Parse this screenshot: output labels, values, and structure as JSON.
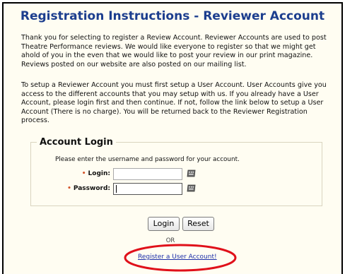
{
  "page": {
    "title": "Registration Instructions - Reviewer Account",
    "paragraph_1": "Thank you for selecting to register a Review Account. Reviewer Accounts are used to post Theatre Performance reviews. We would like everyone to register so that we might get ahold of you in the even that we would like to post your review in our print magazine. Reviews posted on our website are also posted on our mailing list.",
    "paragraph_2": "To setup a Reviewer Account you must first setup a User Account. User Accounts give you access to the different accounts that you may setup with us. If you already have a User Account, please login first and then continue. If not, follow the link below to setup a User Account (There is no charge). You will be returned back to the Reviewer Registration process."
  },
  "login": {
    "legend": "Account Login",
    "instructions": "Please enter the username and password for your account.",
    "required_marker": "•",
    "login_label": "Login:",
    "password_label": "Password:",
    "login_value": "",
    "password_value": "",
    "login_button": "Login",
    "reset_button": "Reset"
  },
  "or_text": "OR",
  "register_link": "Register a User Account!",
  "colors": {
    "title": "#1c3e8e",
    "required": "#d4542a",
    "highlight": "#e0101a",
    "background": "#fffdf2"
  },
  "icons": {
    "keyboard": "keyboard-icon"
  }
}
